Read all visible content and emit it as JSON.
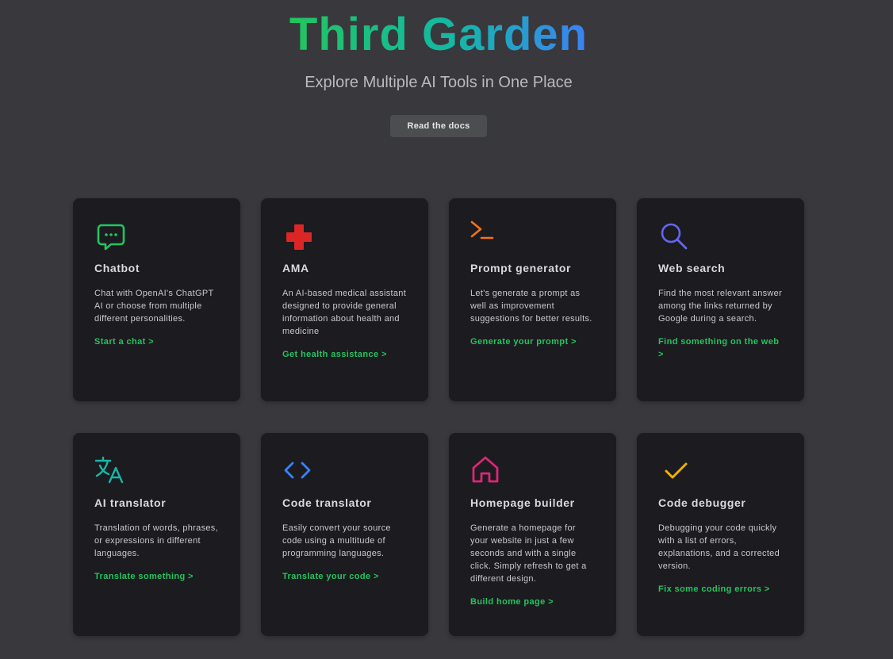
{
  "hero": {
    "title": "Third Garden",
    "subtitle": "Explore Multiple AI Tools in One Place",
    "docs_button": "Read the docs"
  },
  "colors": {
    "background": "#39383d",
    "card": "#1c1b20",
    "link": "#22c55e",
    "title_gradient": [
      "#22c55e",
      "#14b8a6",
      "#3b82f6"
    ]
  },
  "cards": [
    {
      "icon": "chat-icon",
      "icon_color": "#22c55e",
      "title": "Chatbot",
      "description": "Chat with OpenAI's ChatGPT AI or choose from multiple different personalities.",
      "link": "Start a chat >"
    },
    {
      "icon": "medical-cross-icon",
      "icon_color": "#dc2626",
      "title": "AMA",
      "description": "An AI-based medical assistant designed to provide general information about health and medicine",
      "link": "Get health assistance >"
    },
    {
      "icon": "terminal-icon",
      "icon_color": "#f97316",
      "title": "Prompt generator",
      "description": "Let's generate a prompt as well as improvement suggestions for better results.",
      "link": "Generate your prompt >"
    },
    {
      "icon": "search-icon",
      "icon_color": "#6366f1",
      "title": "Web search",
      "description": "Find the most relevant answer among the links returned by Google during a search.",
      "link": "Find something on the web >"
    },
    {
      "icon": "translate-icon",
      "icon_color": "#14b8a6",
      "title": "AI translator",
      "description": "Translation of words, phrases, or expressions in different languages.",
      "link": "Translate something >"
    },
    {
      "icon": "code-icon",
      "icon_color": "#3b82f6",
      "title": "Code translator",
      "description": "Easily convert your source code using a multitude of programming languages.",
      "link": "Translate your code >"
    },
    {
      "icon": "home-icon",
      "icon_color": "#db2777",
      "title": "Homepage builder",
      "description": "Generate a homepage for your website in just a few seconds and with a single click. Simply refresh to get a different design.",
      "link": "Build home page >"
    },
    {
      "icon": "checkmark-icon",
      "icon_color": "#eab308",
      "title": "Code debugger",
      "description": "Debugging your code quickly with a list of errors, explanations, and a corrected version.",
      "link": "Fix some coding errors >"
    }
  ]
}
